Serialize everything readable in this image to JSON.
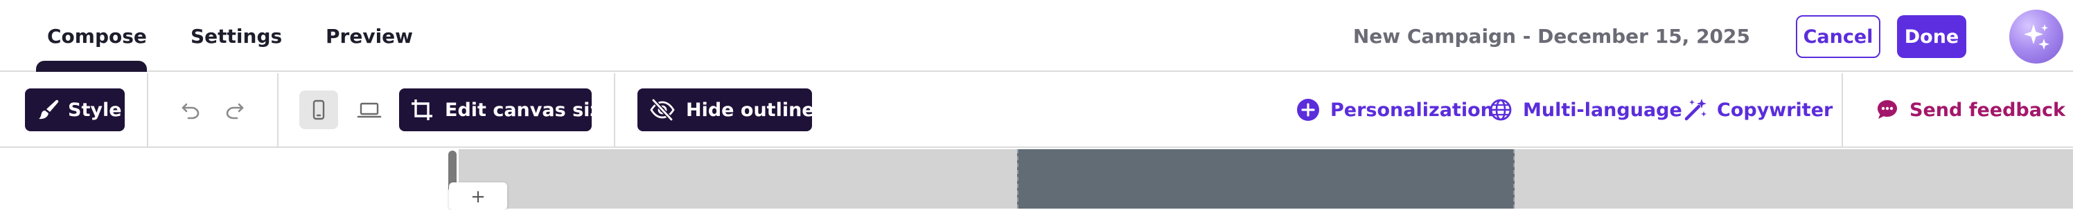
{
  "header": {
    "tabs": [
      {
        "label": "Compose",
        "active": true
      },
      {
        "label": "Settings",
        "active": false
      },
      {
        "label": "Preview",
        "active": false
      }
    ],
    "campaign_title": "New Campaign - December 15, 2025",
    "cancel_label": "Cancel",
    "done_label": "Done",
    "ai_icon": "sparkles-icon"
  },
  "toolbar": {
    "style_label": "Style",
    "undo_icon": "undo-icon",
    "redo_icon": "redo-icon",
    "mobile_icon": "mobile-icon",
    "desktop_icon": "laptop-icon",
    "edit_canvas_label": "Edit canvas size",
    "hide_outlines_label": "Hide outlines",
    "personalization_label": "Personalization",
    "multi_language_label": "Multi-language",
    "copywriter_label": "Copywriter",
    "send_feedback_label": "Send feedback"
  },
  "colors": {
    "accent": "#5b2ddb",
    "dark_button": "#1f1238",
    "feedback": "#a3176a",
    "canvas_bg": "#d3d3d3",
    "preview_bg": "#616c75"
  },
  "canvas": {
    "add_handle_glyph": "+"
  }
}
